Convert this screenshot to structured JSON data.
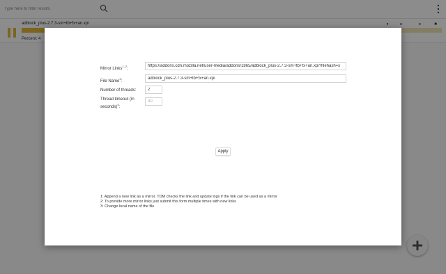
{
  "search": {
    "placeholder": "Type here to filter results"
  },
  "download": {
    "file_name": "adblock_plus-2.7.3-sm+tb+fx+an.xpi",
    "percent_label": "Percent: 4",
    "progress": 0.06,
    "buttons": [
      "⏸",
      "▸",
      "▸",
      "■"
    ]
  },
  "dialog": {
    "mirror_links_label": "Mirror Links",
    "mirror_links_sup": "1, 2",
    "mirror_links_value": "https://addons.cdn.mozilla.net/user-media/addons/1865/adblock_plus-2.7.3-sm+tb+fx+an.xpi?filehash=s",
    "file_name_label": "File Name",
    "file_name_sup": "3",
    "file_name_value": "adblock_plus-2.7.3-sm+tb+fx+an.xpi",
    "threads_label": "Number of threads:",
    "threads_value": "2",
    "timeout_label_line1": "Thread timeout (in",
    "timeout_label_line2": "seconds)",
    "timeout_sup": "4",
    "timeout_value": "30",
    "apply_label": "Apply",
    "notes": [
      "1: Append a new link as a mirror. TDM checks the link and update logs if the link can be used as a mirror",
      "2: To provide more mirror links just submit this form multiple times with new links",
      "3: Change local name of the file"
    ]
  },
  "colors": {
    "accent": "#e2b93b",
    "overlay": "#000000"
  },
  "icons": {
    "search": "search-icon",
    "menu": "kebab-menu-icon",
    "pause": "pause-icon",
    "add": "plus-icon"
  }
}
